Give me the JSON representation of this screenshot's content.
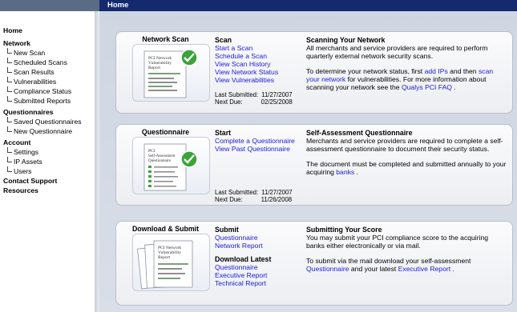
{
  "header": {
    "title": "Home"
  },
  "sidebar": {
    "items": [
      {
        "label": "Home",
        "level": "top"
      },
      {
        "label": "Network",
        "level": "top"
      },
      {
        "label": "New Scan",
        "level": "sub"
      },
      {
        "label": "Scheduled Scans",
        "level": "sub"
      },
      {
        "label": "Scan Results",
        "level": "sub"
      },
      {
        "label": "Vulnerabilities",
        "level": "sub"
      },
      {
        "label": "Compliance Status",
        "level": "sub"
      },
      {
        "label": "Submitted Reports",
        "level": "sub"
      },
      {
        "label": "Questionnaires",
        "level": "top"
      },
      {
        "label": "Saved Questionnaires",
        "level": "sub"
      },
      {
        "label": "New Questionnaire",
        "level": "sub"
      },
      {
        "label": "Account",
        "level": "top"
      },
      {
        "label": "Settings",
        "level": "sub"
      },
      {
        "label": "IP Assets",
        "level": "sub"
      },
      {
        "label": "Users",
        "level": "sub"
      },
      {
        "label": "Contact Support",
        "level": "top"
      },
      {
        "label": "Resources",
        "level": "top"
      }
    ]
  },
  "panels": {
    "network": {
      "thumb_title": "Network Scan",
      "doc_title": "PCI Network Vulnerability Report",
      "heading": "Scan",
      "links": [
        "Start a Scan",
        "Schedule a Scan",
        "View Scan History",
        "View Network Status",
        "View Vulnerabilities"
      ],
      "last_submitted_label": "Last Submitted:",
      "last_submitted": "11/27/2007",
      "next_due_label": "Next Due:",
      "next_due": "02/25/2008",
      "info_heading": "Scanning Your Network",
      "info_p1": "All merchants and service providers are required to perform quarterly external network security scans.",
      "info_p2a": "To determine your network status, first ",
      "info_link1": "add IPs",
      "info_p2b": " and then ",
      "info_link2": "scan your network",
      "info_p2c": " for vulnerabilities. For more information about scanning your network see the ",
      "info_link3": "Qualys PCI FAQ",
      "info_p2d": " ."
    },
    "questionnaire": {
      "thumb_title": "Questionnaire",
      "doc_title": "PCI Self-Assessment Questionnaire",
      "heading": "Start",
      "links": [
        "Complete a Questionnaire",
        "View Past Questionnaire"
      ],
      "last_submitted_label": "Last Submitted:",
      "last_submitted": "11/27/2007",
      "next_due_label": "Next Due:",
      "next_due": "11/26/2008",
      "info_heading": "Self-Assessment Questionnaire",
      "info_p1": "Merchants and service providers are required to complete a self-assessment questionnaire to document their security status.",
      "info_p2a": "The document must be completed and submitted annually to your acquiring ",
      "info_link1": "banks",
      "info_p2b": " ."
    },
    "download": {
      "thumb_title": "Download & Submit",
      "doc_title": "PCI Network Vulnerability Report",
      "heading": "Submit",
      "links": [
        "Questionnaire",
        "Network Report"
      ],
      "heading2": "Download Latest",
      "links2": [
        "Questionnaire",
        "Executive Report",
        "Technical Report"
      ],
      "info_heading": "Submitting Your Score",
      "info_p1": "You may submit your PCI compliance score to the acquiring banks either electronically or via mail.",
      "info_p2a": "To submit via the mail download your self-assessment ",
      "info_link1": "Questionnaire",
      "info_p2b": " and your latest ",
      "info_link2": "Executive Report",
      "info_p2c": " ."
    }
  },
  "colors": {
    "header_bg": "#152a6e",
    "link": "#1a1ad6",
    "check_green": "#3aa33a"
  }
}
